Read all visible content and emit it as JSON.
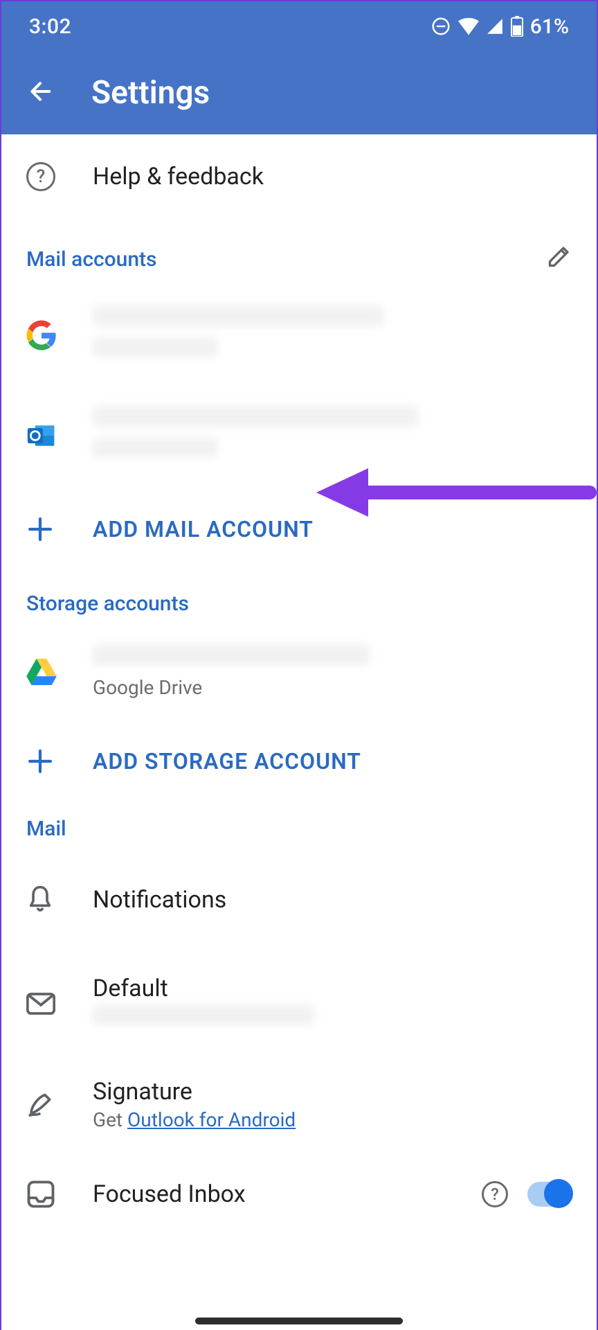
{
  "status": {
    "time": "3:02",
    "battery_pct": "61%"
  },
  "header": {
    "title": "Settings"
  },
  "help_row": {
    "label": "Help & feedback"
  },
  "sections": {
    "mail_accounts": "Mail accounts",
    "storage_accounts": "Storage accounts",
    "mail": "Mail"
  },
  "actions": {
    "add_mail": "ADD MAIL ACCOUNT",
    "add_storage": "ADD STORAGE ACCOUNT"
  },
  "storage": {
    "gdrive_label": "Google Drive"
  },
  "mail_settings": {
    "notifications": "Notifications",
    "default": "Default",
    "signature": {
      "label": "Signature",
      "prefix": "Get ",
      "link": "Outlook for Android"
    },
    "focused_inbox": "Focused Inbox"
  },
  "colors": {
    "accent": "#4673c6",
    "link": "#2a6ac2",
    "arrow": "#863ae6"
  }
}
